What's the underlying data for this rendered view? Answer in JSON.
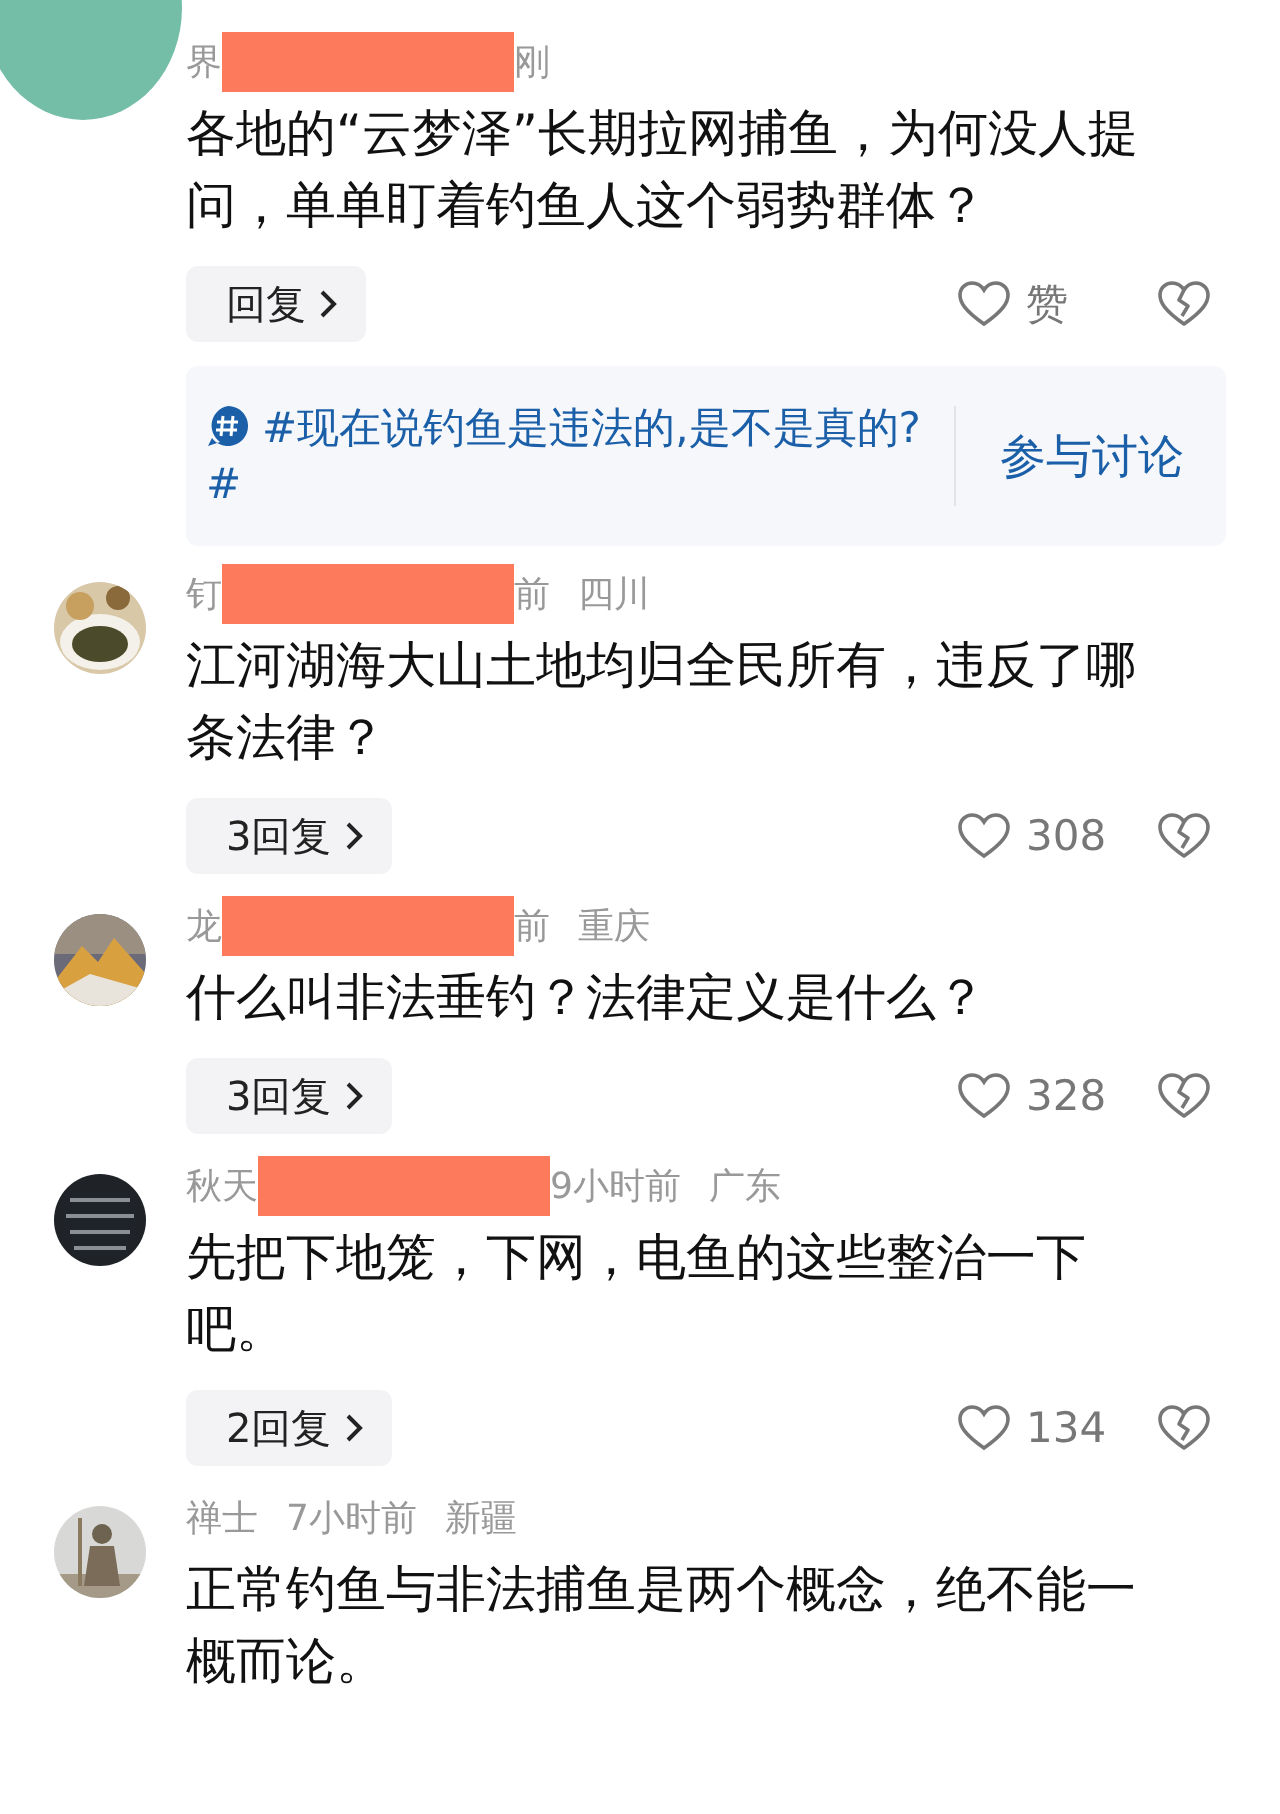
{
  "cover_circle": true,
  "comments": [
    {
      "name": "界",
      "redacted": true,
      "meta": "刚",
      "text": "各地的“云梦泽”长期拉网捕鱼，为何没人提问，单单盯着钓鱼人这个弱势群体？",
      "reply": "回复",
      "likes": "赞",
      "topic": {
        "text": "#现在说钓鱼是违法的,是不是真的?#",
        "action": "参与讨论"
      }
    },
    {
      "avatar": true,
      "name": "钉",
      "redacted": true,
      "meta": "前",
      "location": "四川",
      "text": "江河湖海大山土地均归全民所有，违反了哪条法律？",
      "reply": "3回复",
      "likes": "308"
    },
    {
      "avatar": true,
      "name": "龙",
      "redacted": true,
      "meta": "前",
      "location": "重庆",
      "text": "什么叫非法垂钓？法律定义是什么？",
      "reply": "3回复",
      "likes": "328"
    },
    {
      "avatar": true,
      "name": "秋天",
      "redacted": true,
      "meta": "9小时前",
      "location": "广东",
      "text": "先把下地笼，下网，电鱼的这些整治一下吧。",
      "reply": "2回复",
      "likes": "134"
    },
    {
      "avatar": true,
      "name": "禅士",
      "meta": "7小时前",
      "location": "新疆",
      "text": "正常钓鱼与非法捕鱼是两个概念，绝不能一概而论。"
    }
  ]
}
